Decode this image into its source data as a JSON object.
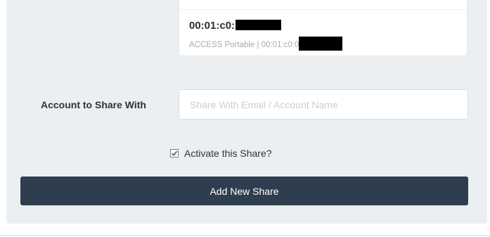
{
  "device": {
    "id_visible": "00:01:c0:",
    "subtitle_visible": "ACCESS Portable | 00:01:c0:0"
  },
  "form": {
    "account_label": "Account to Share With",
    "account_placeholder": "Share With Email / Account Name",
    "account_value": "",
    "activate_label": "Activate this Share?",
    "activate_checked": true,
    "submit_label": "Add New Share"
  },
  "colors": {
    "panel_background": "#eceff1",
    "button_background": "#2e3e4f",
    "button_text": "#ffffff"
  },
  "icons": {
    "checkbox": "checkmark-icon"
  }
}
